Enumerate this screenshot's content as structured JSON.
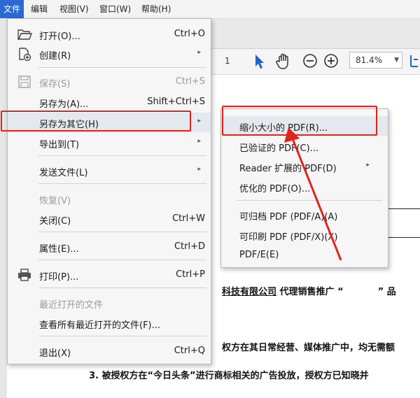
{
  "menubar": {
    "items": [
      {
        "label": "文件"
      },
      {
        "label": "编辑"
      },
      {
        "label": "视图(V)"
      },
      {
        "label": "窗口(W)"
      },
      {
        "label": "帮助(H)"
      }
    ]
  },
  "toolbar": {
    "page_number": "1",
    "zoom": "81.4%"
  },
  "file_menu": {
    "items": [
      {
        "label": "打开(O)...",
        "shortcut": "Ctrl+O"
      },
      {
        "label": "创建(R)"
      },
      {
        "label": "保存(S)",
        "shortcut": "Ctrl+S"
      },
      {
        "label": "另存为(A)...",
        "shortcut": "Shift+Ctrl+S"
      },
      {
        "label": "另存为其它(H)"
      },
      {
        "label": "导出到(T)"
      },
      {
        "label": "发送文件(L)"
      },
      {
        "label": "恢复(V)"
      },
      {
        "label": "关闭(C)",
        "shortcut": "Ctrl+W"
      },
      {
        "label": "属性(E)...",
        "shortcut": "Ctrl+D"
      },
      {
        "label": "打印(P)...",
        "shortcut": "Ctrl+P"
      },
      {
        "label": "最近打开的文件"
      },
      {
        "label": "查看所有最近打开的文件(F)..."
      },
      {
        "label": "退出(X)",
        "shortcut": "Ctrl+Q"
      }
    ]
  },
  "save_as_other_submenu": {
    "items": [
      {
        "label": "缩小大小的 PDF(R)..."
      },
      {
        "label": "已验证的 PDF(C)..."
      },
      {
        "label": "Reader 扩展的 PDF(D)"
      },
      {
        "label": "优化的 PDF(O)..."
      },
      {
        "label": "可归档 PDF (PDF/A)(A)"
      },
      {
        "label": "可印刷 PDF (PDF/X)(X)"
      },
      {
        "label": "PDF/E(E)"
      }
    ]
  },
  "document": {
    "line1": "科技有限公司",
    "line1b": "代理销售推广 “",
    "line1c": "” 品",
    "line2": "权方在其日常经营、媒体推广中，均无需额",
    "line3": "3. 被授权方在“今日头条”进行商标相关的广告投放，授权方已知晓并"
  },
  "colors": {
    "accent": "#2a6ad1",
    "annotation": "#e0231b"
  }
}
